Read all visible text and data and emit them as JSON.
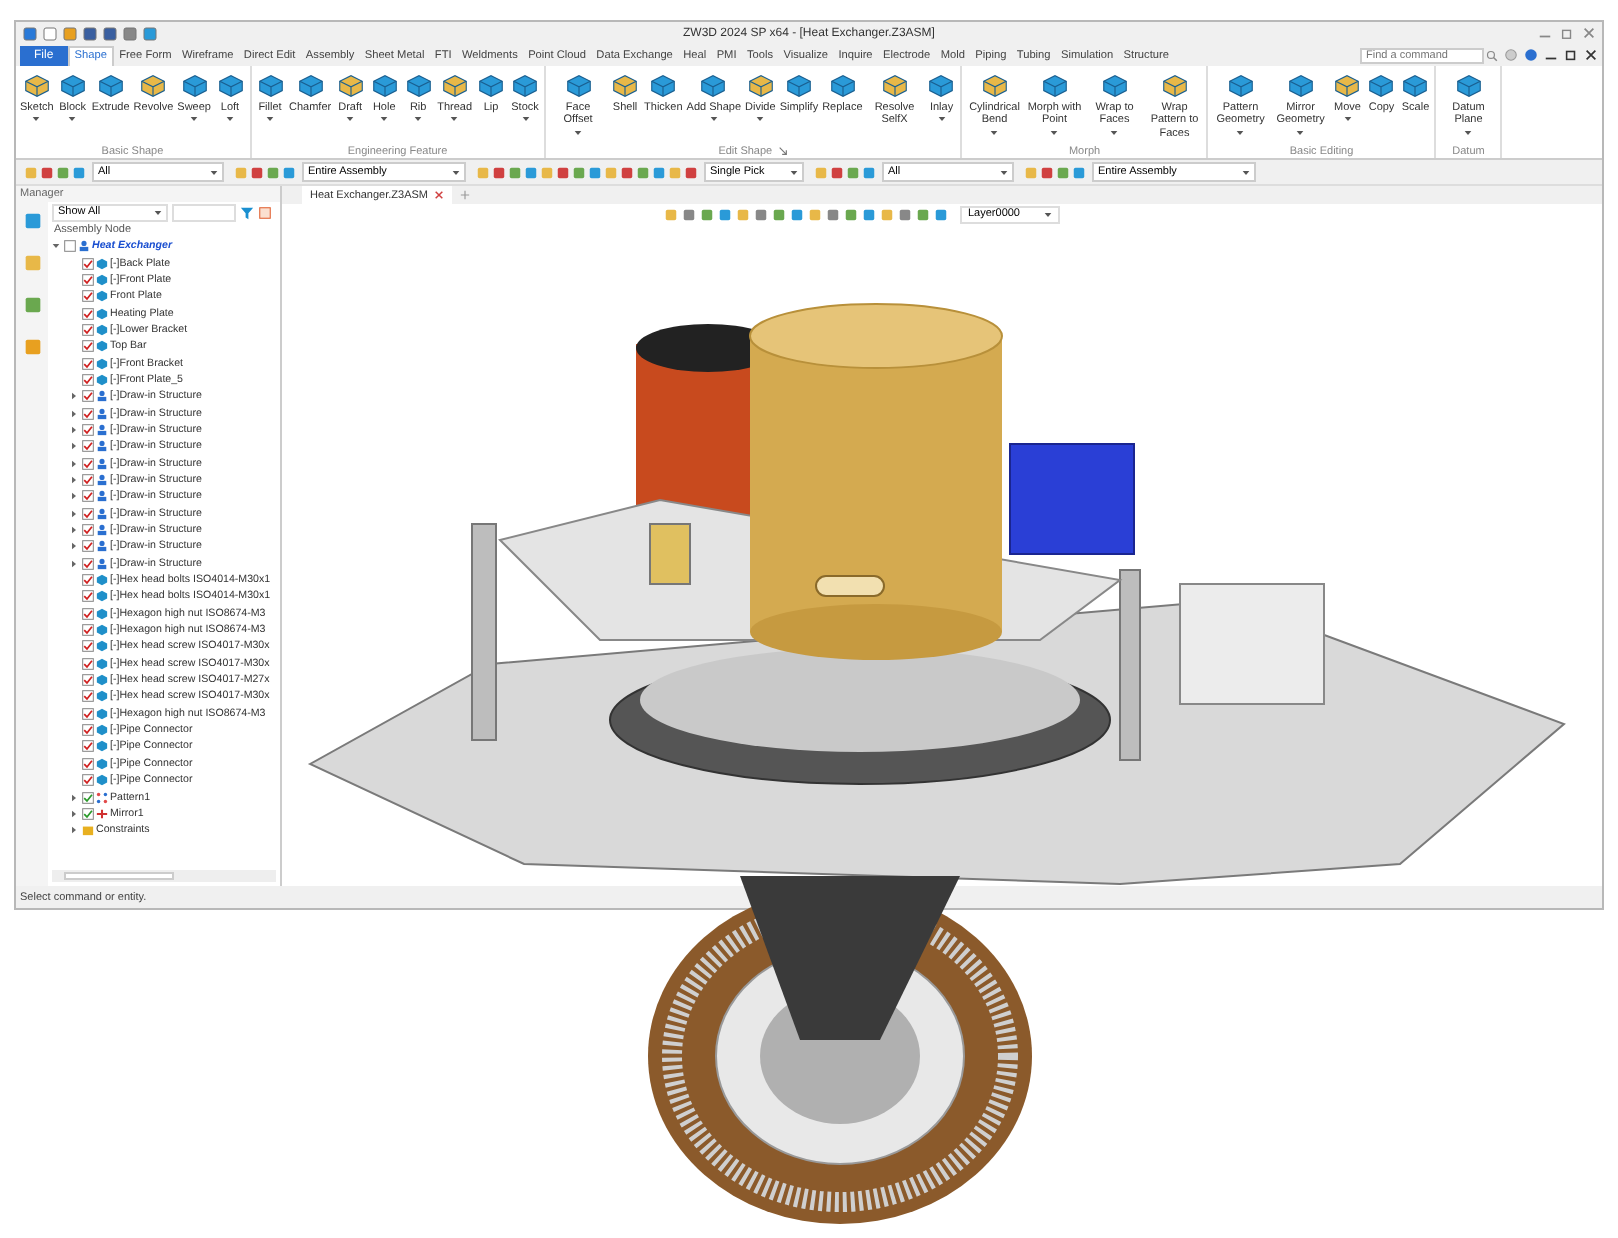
{
  "window": {
    "title": "ZW3D 2024 SP x64 - [Heat Exchanger.Z3ASM]"
  },
  "menu_tabs": [
    {
      "label": "File",
      "selected": false,
      "kind": "file"
    },
    {
      "label": "Shape",
      "selected": true,
      "kind": "tab"
    },
    {
      "label": "Free Form",
      "selected": false,
      "kind": "tab"
    },
    {
      "label": "Wireframe",
      "selected": false,
      "kind": "tab"
    },
    {
      "label": "Direct Edit",
      "selected": false,
      "kind": "tab"
    },
    {
      "label": "Assembly",
      "selected": false,
      "kind": "tab"
    },
    {
      "label": "Sheet Metal",
      "selected": false,
      "kind": "tab"
    },
    {
      "label": "FTI",
      "selected": false,
      "kind": "tab"
    },
    {
      "label": "Weldments",
      "selected": false,
      "kind": "tab"
    },
    {
      "label": "Point Cloud",
      "selected": false,
      "kind": "tab"
    },
    {
      "label": "Data Exchange",
      "selected": false,
      "kind": "tab"
    },
    {
      "label": "Heal",
      "selected": false,
      "kind": "tab"
    },
    {
      "label": "PMI",
      "selected": false,
      "kind": "tab"
    },
    {
      "label": "Tools",
      "selected": false,
      "kind": "tab"
    },
    {
      "label": "Visualize",
      "selected": false,
      "kind": "tab"
    },
    {
      "label": "Inquire",
      "selected": false,
      "kind": "tab"
    },
    {
      "label": "Electrode",
      "selected": false,
      "kind": "tab"
    },
    {
      "label": "Mold",
      "selected": false,
      "kind": "tab"
    },
    {
      "label": "Piping",
      "selected": false,
      "kind": "tab"
    },
    {
      "label": "Tubing",
      "selected": false,
      "kind": "tab"
    },
    {
      "label": "Simulation",
      "selected": false,
      "kind": "tab"
    },
    {
      "label": "Structure",
      "selected": false,
      "kind": "tab"
    }
  ],
  "search": {
    "placeholder": "Find a command"
  },
  "ribbon_groups": [
    {
      "title": "Basic Shape",
      "launcher": false,
      "buttons": [
        {
          "label": "Sketch",
          "dropdown": true
        },
        {
          "label": "Block",
          "dropdown": true
        },
        {
          "label": "Extrude",
          "dropdown": false
        },
        {
          "label": "Revolve",
          "dropdown": false
        },
        {
          "label": "Sweep",
          "dropdown": true
        },
        {
          "label": "Loft",
          "dropdown": true
        }
      ]
    },
    {
      "title": "Engineering Feature",
      "launcher": false,
      "buttons": [
        {
          "label": "Fillet",
          "dropdown": true
        },
        {
          "label": "Chamfer",
          "dropdown": false
        },
        {
          "label": "Draft",
          "dropdown": true
        },
        {
          "label": "Hole",
          "dropdown": true
        },
        {
          "label": "Rib",
          "dropdown": true
        },
        {
          "label": "Thread",
          "dropdown": true
        },
        {
          "label": "Lip",
          "dropdown": false
        },
        {
          "label": "Stock",
          "dropdown": true
        }
      ]
    },
    {
      "title": "Edit Shape",
      "launcher": true,
      "buttons": [
        {
          "label": "Face Offset",
          "dropdown": true
        },
        {
          "label": "Shell",
          "dropdown": false
        },
        {
          "label": "Thicken",
          "dropdown": false
        },
        {
          "label": "Add Shape",
          "dropdown": true
        },
        {
          "label": "Divide",
          "dropdown": true
        },
        {
          "label": "Simplify",
          "dropdown": false
        },
        {
          "label": "Replace",
          "dropdown": false
        },
        {
          "label": "Resolve SelfX",
          "dropdown": false
        },
        {
          "label": "Inlay",
          "dropdown": true
        }
      ]
    },
    {
      "title": "Morph",
      "launcher": false,
      "buttons": [
        {
          "label": "Cylindrical Bend",
          "dropdown": true
        },
        {
          "label": "Morph with Point",
          "dropdown": true
        },
        {
          "label": "Wrap to Faces",
          "dropdown": true
        },
        {
          "label": "Wrap Pattern to Faces",
          "dropdown": false
        }
      ]
    },
    {
      "title": "Basic Editing",
      "launcher": false,
      "buttons": [
        {
          "label": "Pattern Geometry",
          "dropdown": true
        },
        {
          "label": "Mirror Geometry",
          "dropdown": true
        },
        {
          "label": "Move",
          "dropdown": true
        },
        {
          "label": "Copy",
          "dropdown": false
        },
        {
          "label": "Scale",
          "dropdown": false
        }
      ]
    },
    {
      "title": "Datum",
      "launcher": false,
      "buttons": [
        {
          "label": "Datum Plane",
          "dropdown": true
        }
      ]
    }
  ],
  "toolbar_dropdowns": [
    {
      "value": "All"
    },
    {
      "value": "Entire Assembly"
    },
    {
      "value": "Single Pick"
    },
    {
      "value": "All"
    },
    {
      "value": "Entire Assembly"
    }
  ],
  "manager": {
    "title": "Manager",
    "filter": "Show All",
    "column": "Assembly Node"
  },
  "tree": [
    {
      "label": "Heat Exchanger",
      "kind": "assembly",
      "checked": false,
      "expanded": true,
      "children": [
        {
          "label": "[-]Back Plate",
          "kind": "part",
          "checked": true
        },
        {
          "label": "[-]Front Plate",
          "kind": "part",
          "checked": true
        },
        {
          "label": "Front Plate",
          "kind": "part",
          "checked": true
        },
        {
          "label": "Heating Plate",
          "kind": "part",
          "checked": true
        },
        {
          "label": "[-]Lower Bracket",
          "kind": "part",
          "checked": true
        },
        {
          "label": "Top Bar",
          "kind": "part",
          "checked": true
        },
        {
          "label": "[-]Front Bracket",
          "kind": "part",
          "checked": true
        },
        {
          "label": "[-]Front Plate_5",
          "kind": "part",
          "checked": true
        },
        {
          "label": "[-]Draw-in Structure",
          "kind": "subassembly",
          "checked": true,
          "expanded": false
        },
        {
          "label": "[-]Draw-in Structure",
          "kind": "subassembly",
          "checked": true,
          "expanded": false
        },
        {
          "label": "[-]Draw-in Structure",
          "kind": "subassembly",
          "checked": true,
          "expanded": false
        },
        {
          "label": "[-]Draw-in Structure",
          "kind": "subassembly",
          "checked": true,
          "expanded": false
        },
        {
          "label": "[-]Draw-in Structure",
          "kind": "subassembly",
          "checked": true,
          "expanded": false
        },
        {
          "label": "[-]Draw-in Structure",
          "kind": "subassembly",
          "checked": true,
          "expanded": false
        },
        {
          "label": "[-]Draw-in Structure",
          "kind": "subassembly",
          "checked": true,
          "expanded": false
        },
        {
          "label": "[-]Draw-in Structure",
          "kind": "subassembly",
          "checked": true,
          "expanded": false
        },
        {
          "label": "[-]Draw-in Structure",
          "kind": "subassembly",
          "checked": true,
          "expanded": false
        },
        {
          "label": "[-]Draw-in Structure",
          "kind": "subassembly",
          "checked": true,
          "expanded": false
        },
        {
          "label": "[-]Draw-in Structure",
          "kind": "subassembly",
          "checked": true,
          "expanded": false
        },
        {
          "label": "[-]Hex head bolts ISO4014-M30x1",
          "kind": "part",
          "checked": true
        },
        {
          "label": "[-]Hex head bolts ISO4014-M30x1",
          "kind": "part",
          "checked": true
        },
        {
          "label": "[-]Hexagon high nut ISO8674-M3",
          "kind": "part",
          "checked": true
        },
        {
          "label": "[-]Hexagon high nut ISO8674-M3",
          "kind": "part",
          "checked": true
        },
        {
          "label": "[-]Hex head screw ISO4017-M30x",
          "kind": "part",
          "checked": true
        },
        {
          "label": "[-]Hex head screw ISO4017-M30x",
          "kind": "part",
          "checked": true
        },
        {
          "label": "[-]Hex head screw ISO4017-M27x",
          "kind": "part",
          "checked": true
        },
        {
          "label": "[-]Hex head screw ISO4017-M30x",
          "kind": "part",
          "checked": true
        },
        {
          "label": "[-]Hexagon high nut ISO8674-M3",
          "kind": "part",
          "checked": true
        },
        {
          "label": "[-]Pipe Connector",
          "kind": "part",
          "checked": true
        },
        {
          "label": "[-]Pipe Connector",
          "kind": "part",
          "checked": true
        },
        {
          "label": "[-]Pipe Connector",
          "kind": "part",
          "checked": true
        },
        {
          "label": "[-]Pipe Connector",
          "kind": "part",
          "checked": true
        },
        {
          "label": "Pattern1",
          "kind": "pattern",
          "checked": true,
          "expanded": false
        },
        {
          "label": "Mirror1",
          "kind": "mirror",
          "checked": true,
          "expanded": false
        },
        {
          "label": "Constraints",
          "kind": "constraints",
          "expanded": false
        }
      ]
    }
  ],
  "doc_tabs": [
    {
      "label": "Heat Exchanger.Z3ASM",
      "selected": true
    }
  ],
  "viewport_toolbar": {
    "layer": "Layer0000"
  },
  "status_bar": {
    "text": "Select command or entity."
  }
}
